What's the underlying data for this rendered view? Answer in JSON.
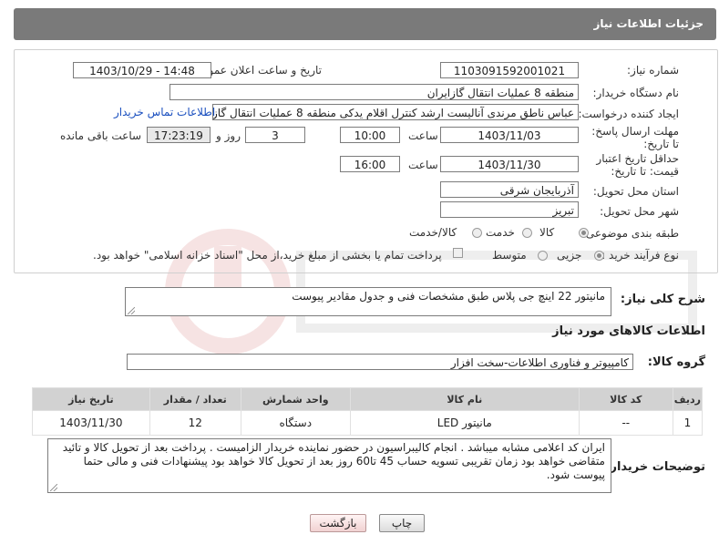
{
  "header": {
    "title": "جزئیات اطلاعات نیاز"
  },
  "form": {
    "need_number": {
      "label": "شماره نیاز:",
      "value": "1103091592001021"
    },
    "announce": {
      "label": "تاریخ و ساعت اعلان عمومی:",
      "value": "1403/10/29 - 14:48"
    },
    "buyer_org": {
      "label": "نام دستگاه خریدار:",
      "value": "منطقه 8 عملیات انتقال گازایران"
    },
    "requester": {
      "label": "ایجاد کننده درخواست:",
      "value": "عباس ناطق مرندی آنالیست ارشد کنترل اقلام یدکی منطقه 8 عملیات انتقال گاز",
      "contact_link": "اطلاعات تماس خریدار"
    },
    "reply_deadline": {
      "label": "مهلت ارسال پاسخ: تا تاریخ:",
      "date": "1403/11/03",
      "time_label": "ساعت",
      "time": "10:00",
      "days": "3",
      "days_label": "روز و",
      "remaining": "17:23:19",
      "remaining_label": "ساعت باقی مانده"
    },
    "price_validity": {
      "label": "حداقل تاریخ اعتبار قیمت: تا تاریخ:",
      "date": "1403/11/30",
      "time_label": "ساعت",
      "time": "16:00"
    },
    "province": {
      "label": "استان محل تحویل:",
      "value": "آذربایجان شرقی"
    },
    "city": {
      "label": "شهر محل تحویل:",
      "value": "تبریز"
    },
    "category": {
      "label": "طبقه بندی موضوعی:",
      "options": [
        "کالا",
        "خدمت",
        "کالا/خدمت"
      ],
      "selected": 0
    },
    "process": {
      "label": "نوع فرآیند خرید :",
      "options": [
        "جزیی",
        "متوسط"
      ],
      "selected": 0,
      "note": "پرداخت تمام یا بخشی از مبلغ خرید،از محل \"اسناد خزانه اسلامی\" خواهد بود."
    }
  },
  "description": {
    "label": "شرح کلی نیاز:",
    "value": "مانیتور 22 اینچ جی پلاس طبق مشخصات فنی و جدول مقادیر پیوست"
  },
  "goods_section": {
    "title": "اطلاعات کالاهای مورد نیاز"
  },
  "goods_group": {
    "label": "گروه کالا:",
    "value": "کامپیوتر و فناوری اطلاعات-سخت افزار"
  },
  "table": {
    "headers": [
      "ردیف",
      "کد کالا",
      "نام کالا",
      "واحد شمارش",
      "تعداد / مقدار",
      "تاریخ نیاز"
    ],
    "rows": [
      [
        "1",
        "--",
        "مانیتور LED",
        "دستگاه",
        "12",
        "1403/11/30"
      ]
    ]
  },
  "buyer_notes": {
    "label": "توضیحات خریدار:",
    "value": "ایران کد اعلامی مشابه میباشد . انجام کالیبراسیون در حضور نماینده خریدار الزامیست . پرداخت  بعد از تحویل کالا و تائید متقاضی خواهد بود زمان  تقریبی تسویه حساب 45 تا60 روز بعد از تحویل کالا خواهد بود پیشنهادات فنی و مالی حتما پیوست شود."
  },
  "buttons": {
    "print": "چاپ",
    "back": "بازگشت"
  },
  "colors": {
    "header_bg": "#7a7a7a",
    "link": "#1a4fbf",
    "table_header": "#d2d2d2"
  }
}
